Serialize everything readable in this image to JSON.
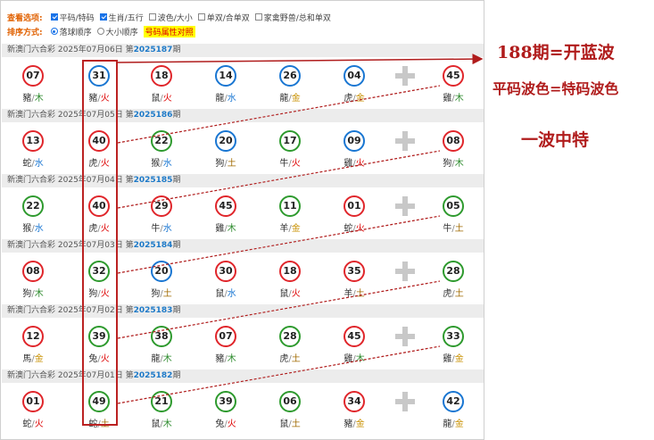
{
  "options": {
    "label": "查看选项:",
    "items": [
      {
        "text": "平码/特码",
        "checked": true
      },
      {
        "text": "生肖/五行",
        "checked": true
      },
      {
        "text": "波色/大小",
        "checked": false
      },
      {
        "text": "单双/合单双",
        "checked": false
      },
      {
        "text": "家禽野兽/总和单双",
        "checked": false
      }
    ]
  },
  "sort": {
    "label": "排序方式:",
    "items": [
      {
        "text": "落球顺序",
        "selected": true
      },
      {
        "text": "大小顺序",
        "selected": false
      }
    ],
    "highlight": "号码属性对照"
  },
  "draws": [
    {
      "lottery": "新澳门六合彩",
      "date": "2025年07月06日",
      "prefix": "第",
      "issue": "2025187",
      "suffix": "期",
      "balls": [
        {
          "n": "07",
          "c": "red",
          "z": "豬",
          "e": "木"
        },
        {
          "n": "31",
          "c": "blue",
          "z": "豬",
          "e": "火"
        },
        {
          "n": "18",
          "c": "red",
          "z": "鼠",
          "e": "火"
        },
        {
          "n": "14",
          "c": "blue",
          "z": "龍",
          "e": "水"
        },
        {
          "n": "26",
          "c": "blue",
          "z": "龍",
          "e": "金"
        },
        {
          "n": "04",
          "c": "blue",
          "z": "虎",
          "e": "金"
        },
        {
          "n": "45",
          "c": "red",
          "z": "雞",
          "e": "木"
        }
      ]
    },
    {
      "lottery": "新澳门六合彩",
      "date": "2025年07月05日",
      "prefix": "第",
      "issue": "2025186",
      "suffix": "期",
      "balls": [
        {
          "n": "13",
          "c": "red",
          "z": "蛇",
          "e": "水"
        },
        {
          "n": "40",
          "c": "red",
          "z": "虎",
          "e": "火"
        },
        {
          "n": "22",
          "c": "green",
          "z": "猴",
          "e": "水"
        },
        {
          "n": "20",
          "c": "blue",
          "z": "狗",
          "e": "土"
        },
        {
          "n": "17",
          "c": "green",
          "z": "牛",
          "e": "火"
        },
        {
          "n": "09",
          "c": "blue",
          "z": "雞",
          "e": "火"
        },
        {
          "n": "08",
          "c": "red",
          "z": "狗",
          "e": "木"
        }
      ]
    },
    {
      "lottery": "新澳门六合彩",
      "date": "2025年07月04日",
      "prefix": "第",
      "issue": "2025185",
      "suffix": "期",
      "balls": [
        {
          "n": "22",
          "c": "green",
          "z": "猴",
          "e": "水"
        },
        {
          "n": "40",
          "c": "red",
          "z": "虎",
          "e": "火"
        },
        {
          "n": "29",
          "c": "red",
          "z": "牛",
          "e": "水"
        },
        {
          "n": "45",
          "c": "red",
          "z": "雞",
          "e": "木"
        },
        {
          "n": "11",
          "c": "green",
          "z": "羊",
          "e": "金"
        },
        {
          "n": "01",
          "c": "red",
          "z": "蛇",
          "e": "火"
        },
        {
          "n": "05",
          "c": "green",
          "z": "牛",
          "e": "土"
        }
      ]
    },
    {
      "lottery": "新澳门六合彩",
      "date": "2025年07月03日",
      "prefix": "第",
      "issue": "2025184",
      "suffix": "期",
      "balls": [
        {
          "n": "08",
          "c": "red",
          "z": "狗",
          "e": "木"
        },
        {
          "n": "32",
          "c": "green",
          "z": "狗",
          "e": "火"
        },
        {
          "n": "20",
          "c": "blue",
          "z": "狗",
          "e": "土"
        },
        {
          "n": "30",
          "c": "red",
          "z": "鼠",
          "e": "水"
        },
        {
          "n": "18",
          "c": "red",
          "z": "鼠",
          "e": "火"
        },
        {
          "n": "35",
          "c": "red",
          "z": "羊",
          "e": "土"
        },
        {
          "n": "28",
          "c": "green",
          "z": "虎",
          "e": "土"
        }
      ]
    },
    {
      "lottery": "新澳门六合彩",
      "date": "2025年07月02日",
      "prefix": "第",
      "issue": "2025183",
      "suffix": "期",
      "balls": [
        {
          "n": "12",
          "c": "red",
          "z": "馬",
          "e": "金"
        },
        {
          "n": "39",
          "c": "green",
          "z": "兔",
          "e": "火"
        },
        {
          "n": "38",
          "c": "green",
          "z": "龍",
          "e": "木"
        },
        {
          "n": "07",
          "c": "red",
          "z": "豬",
          "e": "木"
        },
        {
          "n": "28",
          "c": "green",
          "z": "虎",
          "e": "土"
        },
        {
          "n": "45",
          "c": "red",
          "z": "雞",
          "e": "木"
        },
        {
          "n": "33",
          "c": "green",
          "z": "雞",
          "e": "金"
        }
      ]
    },
    {
      "lottery": "新澳门六合彩",
      "date": "2025年07月01日",
      "prefix": "第",
      "issue": "2025182",
      "suffix": "期",
      "balls": [
        {
          "n": "01",
          "c": "red",
          "z": "蛇",
          "e": "火"
        },
        {
          "n": "49",
          "c": "green",
          "z": "蛇",
          "e": "土"
        },
        {
          "n": "21",
          "c": "green",
          "z": "鼠",
          "e": "木"
        },
        {
          "n": "39",
          "c": "green",
          "z": "兔",
          "e": "火"
        },
        {
          "n": "06",
          "c": "green",
          "z": "鼠",
          "e": "土"
        },
        {
          "n": "34",
          "c": "red",
          "z": "豬",
          "e": "金"
        },
        {
          "n": "42",
          "c": "blue",
          "z": "龍",
          "e": "金"
        }
      ]
    }
  ],
  "annotations": {
    "line1": "188期=开蓝波",
    "line2": "平码波色=特码波色",
    "line3": "一波中特"
  },
  "colors": {
    "red": "#e0262b",
    "blue": "#1976d2",
    "green": "#2e9a2e",
    "annotation": "#b01c1c"
  }
}
